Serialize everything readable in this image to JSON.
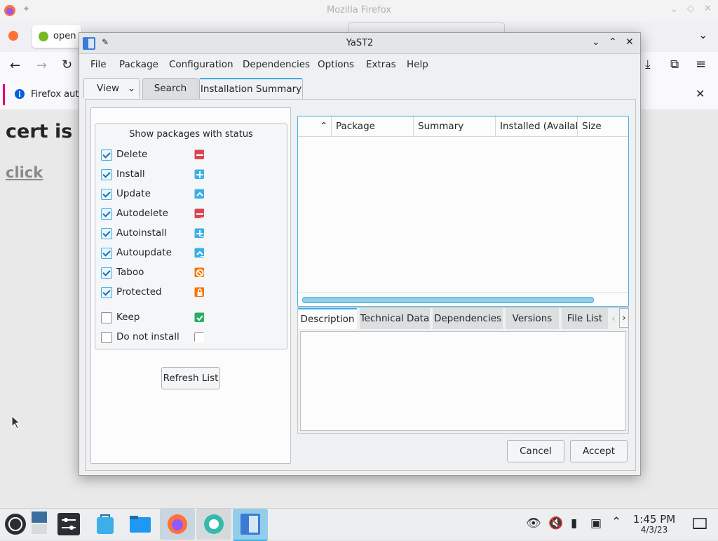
{
  "browser": {
    "window_title": "Mozilla Firefox",
    "tab_label": "open",
    "notice_text": "Firefox aut",
    "page_heading": "cert is l",
    "page_link": "click"
  },
  "yast": {
    "title": "YaST2",
    "menu": [
      "File",
      "Package",
      "Configuration",
      "Dependencies",
      "Options",
      "Extras",
      "Help"
    ],
    "tabs": {
      "view": "View",
      "search": "Search",
      "summary": "Installation Summary"
    },
    "status_group_title": "Show packages with status",
    "statuses": [
      {
        "label": "Delete",
        "checked": true,
        "color": "#da4453",
        "icon": "minus-icon"
      },
      {
        "label": "Install",
        "checked": true,
        "color": "#3daee9",
        "icon": "plus-icon"
      },
      {
        "label": "Update",
        "checked": true,
        "color": "#3daee9",
        "icon": "update-icon"
      },
      {
        "label": "Autodelete",
        "checked": true,
        "color": "#da4453",
        "icon": "auto-minus-icon"
      },
      {
        "label": "Autoinstall",
        "checked": true,
        "color": "#3daee9",
        "icon": "auto-plus-icon"
      },
      {
        "label": "Autoupdate",
        "checked": true,
        "color": "#3daee9",
        "icon": "auto-update-icon"
      },
      {
        "label": "Taboo",
        "checked": true,
        "color": "#f67400",
        "icon": "taboo-icon"
      },
      {
        "label": "Protected",
        "checked": true,
        "color": "#f67400",
        "icon": "lock-icon"
      },
      {
        "label": "Keep",
        "checked": false,
        "color": "#27ae60",
        "icon": "keep-check-icon"
      },
      {
        "label": "Do not install",
        "checked": false,
        "color": "#ffffff",
        "icon": "empty-box-icon"
      }
    ],
    "refresh_label": "Refresh List",
    "columns": [
      "Package",
      "Summary",
      "Installed (Availab",
      "Size"
    ],
    "detail_tabs": [
      "Description",
      "Technical Data",
      "Dependencies",
      "Versions",
      "File List"
    ],
    "cancel_label": "Cancel",
    "accept_label": "Accept"
  },
  "taskbar": {
    "time": "1:45 PM",
    "date": "4/3/23"
  }
}
